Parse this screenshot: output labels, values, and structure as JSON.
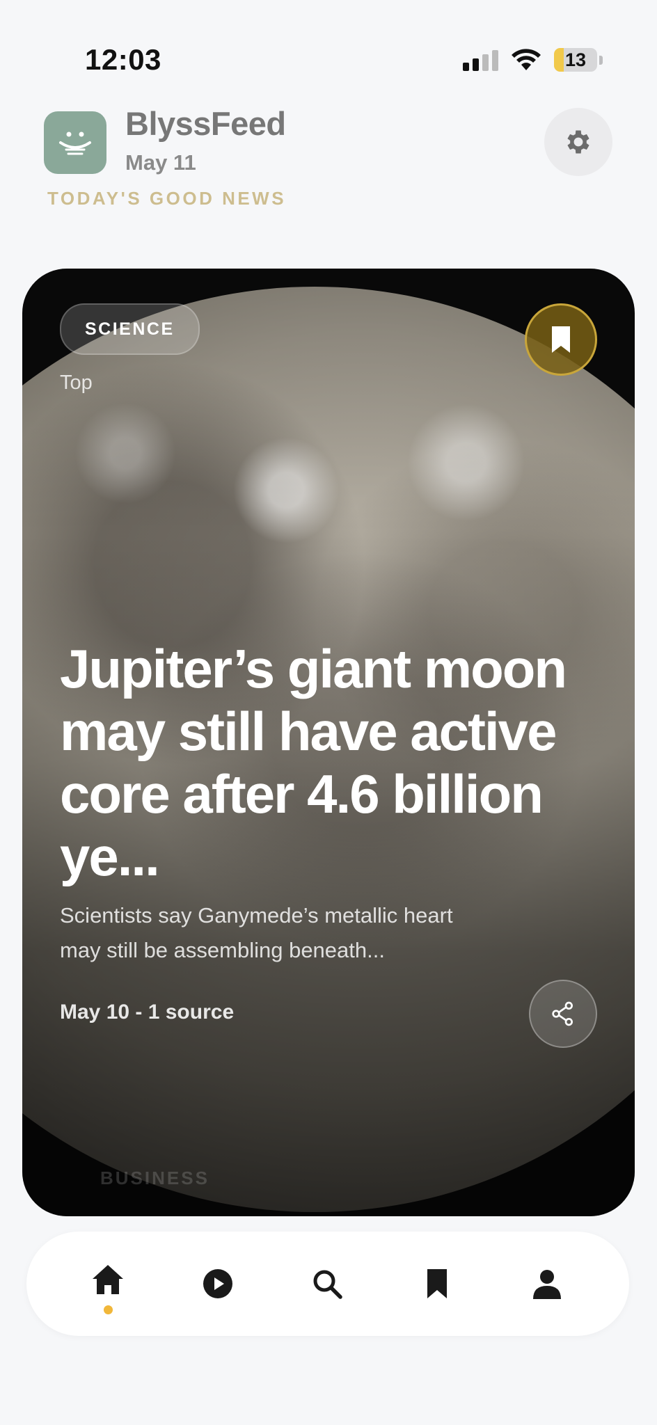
{
  "status_bar": {
    "time": "12:03",
    "battery": "13"
  },
  "header": {
    "app_name": "BlyssFeed",
    "date": "May 11",
    "section_label": "TODAY'S GOOD NEWS",
    "logo_icon": "smile-bowl-icon",
    "settings_icon": "gear-icon"
  },
  "card": {
    "category": "SCIENCE",
    "rank_label": "Top",
    "headline": "Jupiter’s giant moon may still have active core after 4.6 billion ye...",
    "summary": "Scientists say Ganymede’s metallic heart may still be assembling beneath...",
    "meta": "May 10 - 1 source",
    "next_category": "BUSINESS",
    "bookmark_icon": "bookmark-icon",
    "share_icon": "share-icon",
    "bookmark_color": "#c9a63a"
  },
  "bottom_nav": {
    "items": [
      {
        "icon": "home-icon",
        "active": true
      },
      {
        "icon": "play-icon",
        "active": false
      },
      {
        "icon": "search-icon",
        "active": false
      },
      {
        "icon": "bookmark-icon",
        "active": false
      },
      {
        "icon": "profile-icon",
        "active": false
      }
    ],
    "active_color": "#f1b73a"
  }
}
